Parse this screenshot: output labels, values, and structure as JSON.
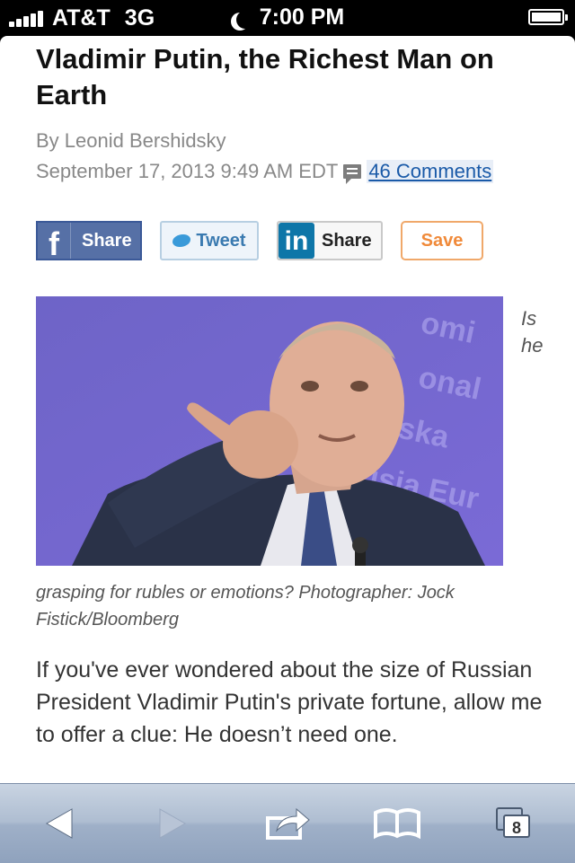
{
  "status_bar": {
    "carrier": "AT&T",
    "network": "3G",
    "time": "7:00 PM",
    "icons": [
      "signal-bars-icon",
      "moon-icon",
      "battery-icon"
    ]
  },
  "article": {
    "headline": "Vladimir Putin, the Richest Man on Earth",
    "byline": "By Leonid Bershidsky",
    "date": "September 17, 2013 9:49 AM EDT",
    "comments_link": "46 Comments",
    "share": {
      "facebook_icon": "f",
      "facebook_label": "Share",
      "twitter_label": "Tweet",
      "linkedin_icon": "in",
      "linkedin_label": "Share",
      "save_label": "Save"
    },
    "caption_side_1": "Is",
    "caption_side_2": "he",
    "caption": "grasping for rubles or emotions? Photographer: Jock Fistick/Bloomberg",
    "body": "If you've ever wondered about the size of Russian President Vladimir Putin's private fortune, allow me to offer a clue: He doesn’t need one."
  },
  "toolbar": {
    "tab_count": "8",
    "icons": [
      "back-arrow-icon",
      "forward-arrow-icon",
      "share-icon",
      "bookmarks-icon",
      "tabs-icon"
    ]
  },
  "colors": {
    "link": "#1a5aa8",
    "facebook": "#3b5998",
    "linkedin": "#0e76a8",
    "save": "#f08a3a",
    "photo_bg": "#7165c9"
  }
}
